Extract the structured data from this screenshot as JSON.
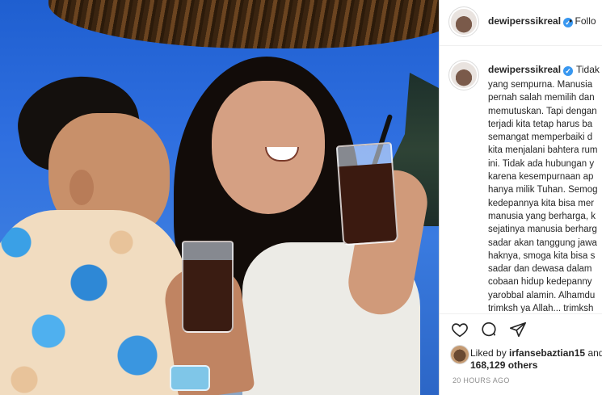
{
  "header": {
    "username": "dewiperssikreal",
    "separator": "•",
    "follow_label": "Follo"
  },
  "caption": {
    "username": "dewiperssikreal",
    "first_fragment": "Tidak a",
    "lines": [
      "yang sempurna. Manusia",
      "pernah salah memilih dan",
      "memutuskan. Tapi dengan",
      "terjadi kita tetap harus ba",
      "semangat memperbaiki d",
      "kita menjalani bahtera rum",
      "ini. Tidak ada hubungan y",
      "karena kesempurnaan ap",
      "hanya milik Tuhan. Semog",
      "kedepannya kita bisa mer",
      "manusia yang berharga, k",
      "sejatinya manusia berharg",
      "sadar akan tanggung jawa",
      "haknya, smoga kita bisa s",
      "sadar dan dewasa dalam",
      "cobaan hidup kedepanny",
      "yarobbal alamin. Alhamdu",
      "trimksh ya Allah... trimksh"
    ]
  },
  "actions": {
    "like_icon": "heart-icon",
    "comment_icon": "comment-icon",
    "share_icon": "share-icon",
    "liked_prefix": "Liked by",
    "liked_user": "irfansebaztian15",
    "liked_suffix": "and",
    "likes_count": "168,129 others",
    "timestamp": "20 HOURS AGO"
  },
  "colors": {
    "verified": "#3897f0",
    "text": "#262626",
    "muted": "#8e8e8e",
    "divider": "#dbdbdb"
  }
}
